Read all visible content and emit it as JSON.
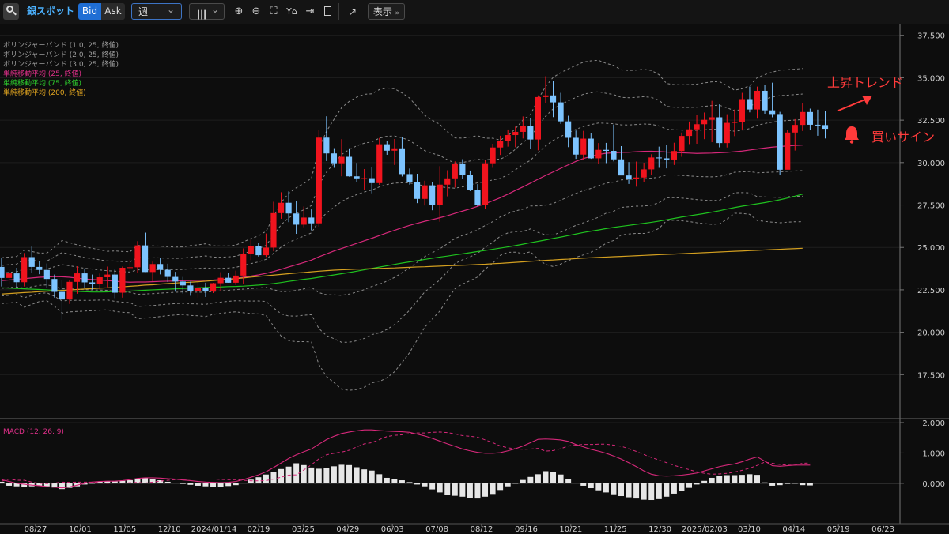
{
  "toolbar": {
    "instrument": "銀スポット",
    "bid_label": "Bid",
    "ask_label": "Ask",
    "period": "週",
    "display_label": "表示",
    "chevron": "⌄"
  },
  "legends": {
    "bb1": "ボリンジャーバンド (1.0, 25, 終値)",
    "bb2": "ボリンジャーバンド (2.0, 25, 終値)",
    "bb3": "ボリンジャーバンド (3.0, 25, 終値)",
    "ma25": "単純移動平均 (25, 終値)",
    "ma75": "単純移動平均 (75, 終値)",
    "ma200": "単純移動平均 (200, 終値)",
    "macd": "MACD (12, 26, 9)"
  },
  "annotations": {
    "uptrend": "上昇トレンド",
    "buy_signal": "買いサイン"
  },
  "colors": {
    "up": "#f0141e",
    "down": "#7dc4ff",
    "ma25": "#d6287a",
    "ma75": "#1fc21f",
    "ma200": "#d4a020",
    "bands": "#8a8a8a",
    "annotation": "#ff3b3b",
    "macd_line": "#d6287a",
    "hist": "#e6e6e6"
  },
  "chart_data": {
    "type": "candlestick",
    "interval": "weekly",
    "price_axis": {
      "min": 15000,
      "max": 38000,
      "ticks": [
        "17.500",
        "20.000",
        "22.500",
        "25.000",
        "27.500",
        "30.000",
        "32.500",
        "35.000",
        "37.500"
      ],
      "tick_values": [
        17500,
        20000,
        22500,
        25000,
        27500,
        30000,
        32500,
        35000,
        37500
      ]
    },
    "macd_axis": {
      "min": -1.2,
      "max": 2.0,
      "ticks": [
        "0.000",
        "1.000",
        "2.000"
      ],
      "tick_values": [
        0,
        1,
        2
      ]
    },
    "x_labels": [
      "08/27",
      "10/01",
      "11/05",
      "12/10",
      "2024/01/14",
      "02/19",
      "03/25",
      "04/29",
      "06/03",
      "07/08",
      "08/12",
      "09/16",
      "10/21",
      "11/25",
      "12/30",
      "2025/02/03",
      "03/10",
      "04/14",
      "05/19",
      "06/23"
    ],
    "candles": [
      [
        23850,
        24380,
        22700,
        23200
      ],
      [
        23200,
        23690,
        22870,
        23470
      ],
      [
        23470,
        23800,
        22650,
        22950
      ],
      [
        22950,
        24670,
        22700,
        24430
      ],
      [
        24430,
        25050,
        23520,
        23850
      ],
      [
        23850,
        24180,
        23420,
        23670
      ],
      [
        23670,
        24050,
        22600,
        23140
      ],
      [
        23140,
        23400,
        22040,
        22380
      ],
      [
        22380,
        23100,
        20720,
        21930
      ],
      [
        21930,
        23080,
        21670,
        22970
      ],
      [
        22970,
        23890,
        22270,
        23470
      ],
      [
        23470,
        23760,
        22610,
        22940
      ],
      [
        22940,
        23400,
        22520,
        22830
      ],
      [
        22830,
        23460,
        22510,
        23240
      ],
      [
        23240,
        23870,
        22650,
        23400
      ],
      [
        23400,
        23700,
        22010,
        22330
      ],
      [
        22330,
        23870,
        22040,
        23800
      ],
      [
        23800,
        24280,
        23560,
        23830
      ],
      [
        23830,
        25370,
        23480,
        25120
      ],
      [
        25120,
        25870,
        23550,
        23550
      ],
      [
        23550,
        24160,
        23010,
        24020
      ],
      [
        24020,
        24360,
        23410,
        23680
      ],
      [
        23680,
        24040,
        22960,
        23260
      ],
      [
        23260,
        23560,
        22390,
        22990
      ],
      [
        22990,
        23260,
        22280,
        22760
      ],
      [
        22760,
        22990,
        22150,
        22440
      ],
      [
        22440,
        23030,
        22040,
        22630
      ],
      [
        22630,
        22920,
        22080,
        22400
      ],
      [
        22400,
        22910,
        22310,
        22890
      ],
      [
        22890,
        23540,
        22450,
        23210
      ],
      [
        23210,
        23480,
        22920,
        22920
      ],
      [
        22920,
        23630,
        22780,
        23340
      ],
      [
        23340,
        24940,
        22870,
        24600
      ],
      [
        24600,
        25440,
        24250,
        25080
      ],
      [
        25080,
        25250,
        24460,
        24540
      ],
      [
        24540,
        25820,
        24440,
        24990
      ],
      [
        24990,
        27690,
        24770,
        27020
      ],
      [
        27020,
        28250,
        26690,
        27630
      ],
      [
        27630,
        28300,
        26490,
        27000
      ],
      [
        27000,
        27720,
        25800,
        26340
      ],
      [
        26340,
        27410,
        26190,
        26760
      ],
      [
        26760,
        27240,
        26010,
        26420
      ],
      [
        26420,
        31910,
        26220,
        31470
      ],
      [
        31470,
        32730,
        30090,
        30540
      ],
      [
        30540,
        30850,
        29690,
        29960
      ],
      [
        29960,
        31380,
        29190,
        30340
      ],
      [
        30340,
        30840,
        29170,
        29190
      ],
      [
        29190,
        29980,
        28870,
        29070
      ],
      [
        29070,
        29620,
        28390,
        29080
      ],
      [
        29080,
        29720,
        28190,
        28790
      ],
      [
        28790,
        31450,
        28690,
        31080
      ],
      [
        31080,
        31290,
        30460,
        30700
      ],
      [
        30700,
        31390,
        29860,
        30840
      ],
      [
        30840,
        31490,
        29180,
        29320
      ],
      [
        29320,
        29650,
        28700,
        28830
      ],
      [
        28830,
        29340,
        27610,
        27860
      ],
      [
        27860,
        28930,
        27470,
        28660
      ],
      [
        28660,
        28860,
        27190,
        27520
      ],
      [
        27520,
        29790,
        26510,
        28700
      ],
      [
        28700,
        29550,
        28010,
        29070
      ],
      [
        29070,
        30070,
        28530,
        29950
      ],
      [
        29950,
        30200,
        29040,
        29290
      ],
      [
        29290,
        29530,
        28320,
        28380
      ],
      [
        28380,
        28730,
        27430,
        27480
      ],
      [
        27480,
        30160,
        27250,
        29960
      ],
      [
        29960,
        31110,
        29690,
        30890
      ],
      [
        30890,
        31580,
        30450,
        31280
      ],
      [
        31280,
        31950,
        30940,
        31620
      ],
      [
        31620,
        32120,
        30910,
        31810
      ],
      [
        31810,
        32720,
        31420,
        32180
      ],
      [
        32180,
        32640,
        30810,
        31360
      ],
      [
        31360,
        33960,
        30720,
        33860
      ],
      [
        33860,
        35090,
        33510,
        33960
      ],
      [
        33960,
        34790,
        32680,
        33550
      ],
      [
        33550,
        34110,
        32280,
        32430
      ],
      [
        32430,
        32760,
        30910,
        31460
      ],
      [
        31460,
        31890,
        30220,
        30470
      ],
      [
        30470,
        31870,
        30150,
        31410
      ],
      [
        31410,
        31760,
        30220,
        30250
      ],
      [
        30250,
        31150,
        29910,
        30750
      ],
      [
        30750,
        31160,
        29970,
        30690
      ],
      [
        30690,
        32240,
        30070,
        30190
      ],
      [
        30190,
        30970,
        29340,
        29240
      ],
      [
        29240,
        30030,
        28740,
        29030
      ],
      [
        29030,
        30060,
        28580,
        29120
      ],
      [
        29120,
        29990,
        28860,
        29600
      ],
      [
        29600,
        30490,
        29270,
        30300
      ],
      [
        30300,
        30940,
        29690,
        30250
      ],
      [
        30250,
        31030,
        29660,
        30180
      ],
      [
        30180,
        31170,
        29860,
        30680
      ],
      [
        30680,
        31770,
        30340,
        31570
      ],
      [
        31570,
        32420,
        31090,
        31960
      ],
      [
        31960,
        32820,
        31110,
        32260
      ],
      [
        32260,
        32950,
        31380,
        32520
      ],
      [
        32520,
        33640,
        31200,
        32670
      ],
      [
        32670,
        33430,
        30900,
        31150
      ],
      [
        31150,
        32850,
        30890,
        32340
      ],
      [
        32340,
        33130,
        31560,
        32410
      ],
      [
        32410,
        34110,
        31950,
        33740
      ],
      [
        33740,
        34480,
        32960,
        33130
      ],
      [
        33130,
        34480,
        32590,
        34230
      ],
      [
        34230,
        34600,
        32880,
        33080
      ],
      [
        33080,
        34710,
        32670,
        32860
      ],
      [
        32860,
        32990,
        29260,
        29580
      ],
      [
        29580,
        31910,
        29720,
        31770
      ],
      [
        31770,
        32560,
        30710,
        32220
      ],
      [
        32220,
        33510,
        31860,
        32980
      ],
      [
        32980,
        33180,
        31900,
        32230
      ],
      [
        32230,
        33120,
        31580,
        32210
      ],
      [
        32210,
        33030,
        31420,
        31990
      ]
    ],
    "series": [
      {
        "name": "単純移動平均 (25, 終値)",
        "values": [
          23040,
          23080,
          23120,
          23160,
          23200,
          23240,
          23260,
          23280,
          23270,
          23240,
          23190,
          23140,
          23110,
          23080,
          23050,
          23010,
          22970,
          22950,
          22960,
          22960,
          22980,
          23000,
          23010,
          23020,
          23040,
          23050,
          23060,
          23070,
          23080,
          23100,
          23130,
          23170,
          23240,
          23310,
          23380,
          23470,
          23580,
          23710,
          23850,
          23980,
          24110,
          24250,
          24450,
          24620,
          24790,
          24940,
          25090,
          25240,
          25390,
          25540,
          25700,
          25860,
          26010,
          26160,
          26300,
          26420,
          26540,
          26640,
          26750,
          26870,
          27010,
          27140,
          27270,
          27420,
          27580,
          27750,
          27930,
          28140,
          28360,
          28570,
          28790,
          29020,
          29240,
          29450,
          29660,
          29870,
          30070,
          30240,
          30360,
          30480,
          30550,
          30570,
          30600,
          30610,
          30640,
          30660,
          30670,
          30650,
          30620,
          30600,
          30580,
          30560,
          30540,
          30550,
          30560,
          30580,
          30600,
          30640,
          30680,
          30740,
          30800,
          30860,
          30910,
          30950,
          30980,
          31010,
          31030
        ]
      },
      {
        "name": "単純移動平均 (75, 終値)",
        "values": [
          22620,
          22600,
          22580,
          22560,
          22540,
          22520,
          22500,
          22470,
          22450,
          22430,
          22410,
          22390,
          22370,
          22370,
          22380,
          22400,
          22410,
          22420,
          22450,
          22480,
          22500,
          22520,
          22540,
          22560,
          22580,
          22600,
          22620,
          22640,
          22660,
          22670,
          22690,
          22700,
          22720,
          22750,
          22780,
          22820,
          22870,
          22930,
          23000,
          23060,
          23120,
          23170,
          23240,
          23310,
          23380,
          23450,
          23520,
          23600,
          23680,
          23760,
          23840,
          23920,
          24000,
          24080,
          24150,
          24220,
          24290,
          24360,
          24430,
          24490,
          24560,
          24620,
          24690,
          24760,
          24820,
          24890,
          24960,
          25030,
          25110,
          25190,
          25280,
          25360,
          25440,
          25530,
          25610,
          25700,
          25790,
          25880,
          25960,
          26030,
          26110,
          26180,
          26240,
          26300,
          26360,
          26420,
          26480,
          26550,
          26630,
          26710,
          26790,
          26860,
          26930,
          27000,
          27080,
          27160,
          27260,
          27350,
          27430,
          27500,
          27570,
          27640,
          27720,
          27810,
          27910,
          28020,
          28140
        ]
      },
      {
        "name": "単純移動平均 (200, 終値)",
        "values": [
          22250,
          22280,
          22310,
          22340,
          22360,
          22390,
          22420,
          22440,
          22470,
          22490,
          22520,
          22550,
          22570,
          22600,
          22620,
          22650,
          22680,
          22710,
          22740,
          22780,
          22800,
          22840,
          22870,
          22900,
          22930,
          22950,
          22980,
          23010,
          23050,
          23080,
          23120,
          23160,
          23200,
          23250,
          23290,
          23330,
          23370,
          23410,
          23450,
          23490,
          23520,
          23560,
          23600,
          23630,
          23660,
          23680,
          23700,
          23720,
          23730,
          23750,
          23760,
          23780,
          23790,
          23810,
          23830,
          23850,
          23860,
          23880,
          23900,
          23920,
          23930,
          23950,
          23970,
          23990,
          24010,
          24040,
          24060,
          24090,
          24120,
          24150,
          24180,
          24210,
          24240,
          24260,
          24290,
          24310,
          24340,
          24370,
          24390,
          24410,
          24430,
          24450,
          24470,
          24490,
          24510,
          24530,
          24550,
          24570,
          24590,
          24610,
          24630,
          24650,
          24670,
          24690,
          24710,
          24730,
          24750,
          24770,
          24790,
          24810,
          24830,
          24850,
          24870,
          24890,
          24910,
          24930,
          24950
        ]
      }
    ],
    "macd": {
      "macd": [
        0.12,
        0.06,
        0.0,
        -0.03,
        -0.06,
        -0.08,
        -0.11,
        -0.13,
        -0.15,
        -0.12,
        -0.06,
        0.0,
        0.04,
        0.06,
        0.07,
        0.07,
        0.09,
        0.12,
        0.16,
        0.18,
        0.18,
        0.17,
        0.15,
        0.14,
        0.11,
        0.09,
        0.06,
        0.04,
        0.03,
        0.02,
        0.03,
        0.06,
        0.12,
        0.2,
        0.28,
        0.38,
        0.52,
        0.67,
        0.82,
        0.94,
        1.04,
        1.13,
        1.29,
        1.44,
        1.55,
        1.64,
        1.69,
        1.73,
        1.76,
        1.76,
        1.74,
        1.72,
        1.71,
        1.7,
        1.68,
        1.62,
        1.56,
        1.48,
        1.39,
        1.3,
        1.22,
        1.13,
        1.07,
        1.02,
        0.99,
        0.99,
        1.01,
        1.07,
        1.14,
        1.23,
        1.34,
        1.45,
        1.46,
        1.45,
        1.43,
        1.38,
        1.28,
        1.2,
        1.12,
        1.06,
        0.99,
        0.9,
        0.8,
        0.68,
        0.55,
        0.41,
        0.3,
        0.25,
        0.24,
        0.25,
        0.27,
        0.3,
        0.34,
        0.41,
        0.48,
        0.55,
        0.6,
        0.64,
        0.71,
        0.8,
        0.87,
        0.73,
        0.58,
        0.56,
        0.58,
        0.6,
        0.6,
        0.6
      ]
    },
    "macd_signal": [],
    "histogram": [
      0.05,
      -0.08,
      -0.1,
      -0.13,
      -0.1,
      -0.08,
      -0.1,
      -0.14,
      -0.19,
      -0.15,
      -0.1,
      -0.04,
      0.0,
      0.05,
      0.07,
      0.06,
      0.08,
      0.1,
      0.13,
      0.17,
      0.14,
      0.1,
      0.05,
      0.02,
      -0.02,
      -0.05,
      -0.08,
      -0.1,
      -0.11,
      -0.11,
      -0.09,
      -0.06,
      0.02,
      0.12,
      0.2,
      0.29,
      0.38,
      0.47,
      0.55,
      0.66,
      0.6,
      0.52,
      0.48,
      0.5,
      0.56,
      0.61,
      0.6,
      0.53,
      0.46,
      0.42,
      0.3,
      0.18,
      0.13,
      0.1,
      0.04,
      -0.04,
      -0.1,
      -0.2,
      -0.3,
      -0.37,
      -0.41,
      -0.44,
      -0.48,
      -0.5,
      -0.44,
      -0.35,
      -0.22,
      -0.1,
      0.0,
      0.11,
      0.21,
      0.3,
      0.4,
      0.37,
      0.29,
      0.15,
      0.02,
      -0.08,
      -0.16,
      -0.23,
      -0.3,
      -0.36,
      -0.42,
      -0.46,
      -0.5,
      -0.54,
      -0.55,
      -0.52,
      -0.44,
      -0.34,
      -0.25,
      -0.15,
      -0.04,
      0.08,
      0.18,
      0.24,
      0.27,
      0.27,
      0.28,
      0.3,
      0.28,
      0.03,
      -0.08,
      -0.06,
      -0.02,
      0.0,
      -0.06,
      -0.07
    ]
  }
}
